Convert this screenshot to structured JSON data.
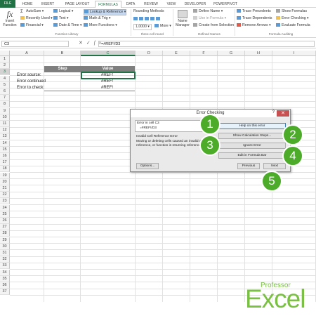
{
  "ribbon_tabs": [
    "FILE",
    "HOME",
    "INSERT",
    "PAGE LAYOUT",
    "FORMULAS",
    "DATA",
    "REVIEW",
    "VIEW",
    "DEVELOPER",
    "POWERPIVOT"
  ],
  "active_tab": "FORMULAS",
  "ribbon": {
    "insert_function": "Insert Function",
    "autosum": "AutoSum",
    "recently_used": "Recently Used",
    "financial": "Financial",
    "logical": "Logical",
    "text": "Text",
    "date_time": "Date & Time",
    "lookup_reference": "Lookup & Reference",
    "math_trig": "Math & Trig",
    "more_functions": "More Functions",
    "function_library_label": "Function Library",
    "rounding_methods": "Rounding Methods",
    "rounding_value": "1,0000",
    "more_label": "More",
    "three_cell_round_label": "three-cell round",
    "name_manager": "Name Manager",
    "define_name": "Define Name",
    "use_in_formula": "Use in Formula",
    "create_from_selection": "Create from Selection",
    "defined_names_label": "Defined Names",
    "trace_precedents": "Trace Precedents",
    "trace_dependents": "Trace Dependents",
    "remove_arrows": "Remove Arrows",
    "show_formulas": "Show Formulas",
    "error_checking": "Error Checking",
    "evaluate_formula": "Evaluate Formula",
    "formula_auditing_label": "Formula Auditing"
  },
  "formula_bar": {
    "name_box": "C3",
    "fx": "fx",
    "formula": "=#REF!/D3"
  },
  "columns": [
    "A",
    "B",
    "C",
    "D",
    "E",
    "F",
    "G",
    "H",
    "I"
  ],
  "rows": [
    "1",
    "2",
    "3",
    "4",
    "5",
    "6",
    "7",
    "8",
    "9",
    "10",
    "11",
    "12",
    "13",
    "14",
    "15",
    "16",
    "17",
    "18",
    "19",
    "20",
    "21",
    "22",
    "23",
    "24",
    "25",
    "26",
    "27",
    "28",
    "29",
    "30",
    "31",
    "32",
    "33",
    "34",
    "35",
    "36",
    "37"
  ],
  "table": {
    "header_step": "Step",
    "header_value": "Value",
    "rows": [
      {
        "step": "Error source:",
        "value": "#REF!"
      },
      {
        "step": "Error continued",
        "value": "#REF!"
      },
      {
        "step": "Error to check:",
        "value": "#REF!"
      }
    ]
  },
  "dialog": {
    "title": "Error Checking",
    "help": "?",
    "close": "✕",
    "error_in_cell": "Error in cell C3",
    "cell_formula": "=#REF!/D3",
    "error_type": "Invalid Cell Reference Error",
    "description": "Moving or deleting cells caused an invalid cell reference, or function is returning reference error.",
    "help_btn": "Help on this error",
    "show_calc_btn": "Show Calculation Steps...",
    "ignore_btn": "Ignore Error",
    "edit_formula_btn": "Edit in Formula Bar",
    "options_btn": "Options...",
    "previous_btn": "Previous",
    "next_btn": "Next"
  },
  "badges": [
    "1",
    "2",
    "3",
    "4",
    "5"
  ],
  "logo": {
    "professor": "Professor",
    "excel": "Excel"
  },
  "colors": {
    "excel_green": "#217346",
    "badge_green": "#4cac2a",
    "logo_green": "#7ac143",
    "table_header_gray": "#7f7f7f"
  }
}
